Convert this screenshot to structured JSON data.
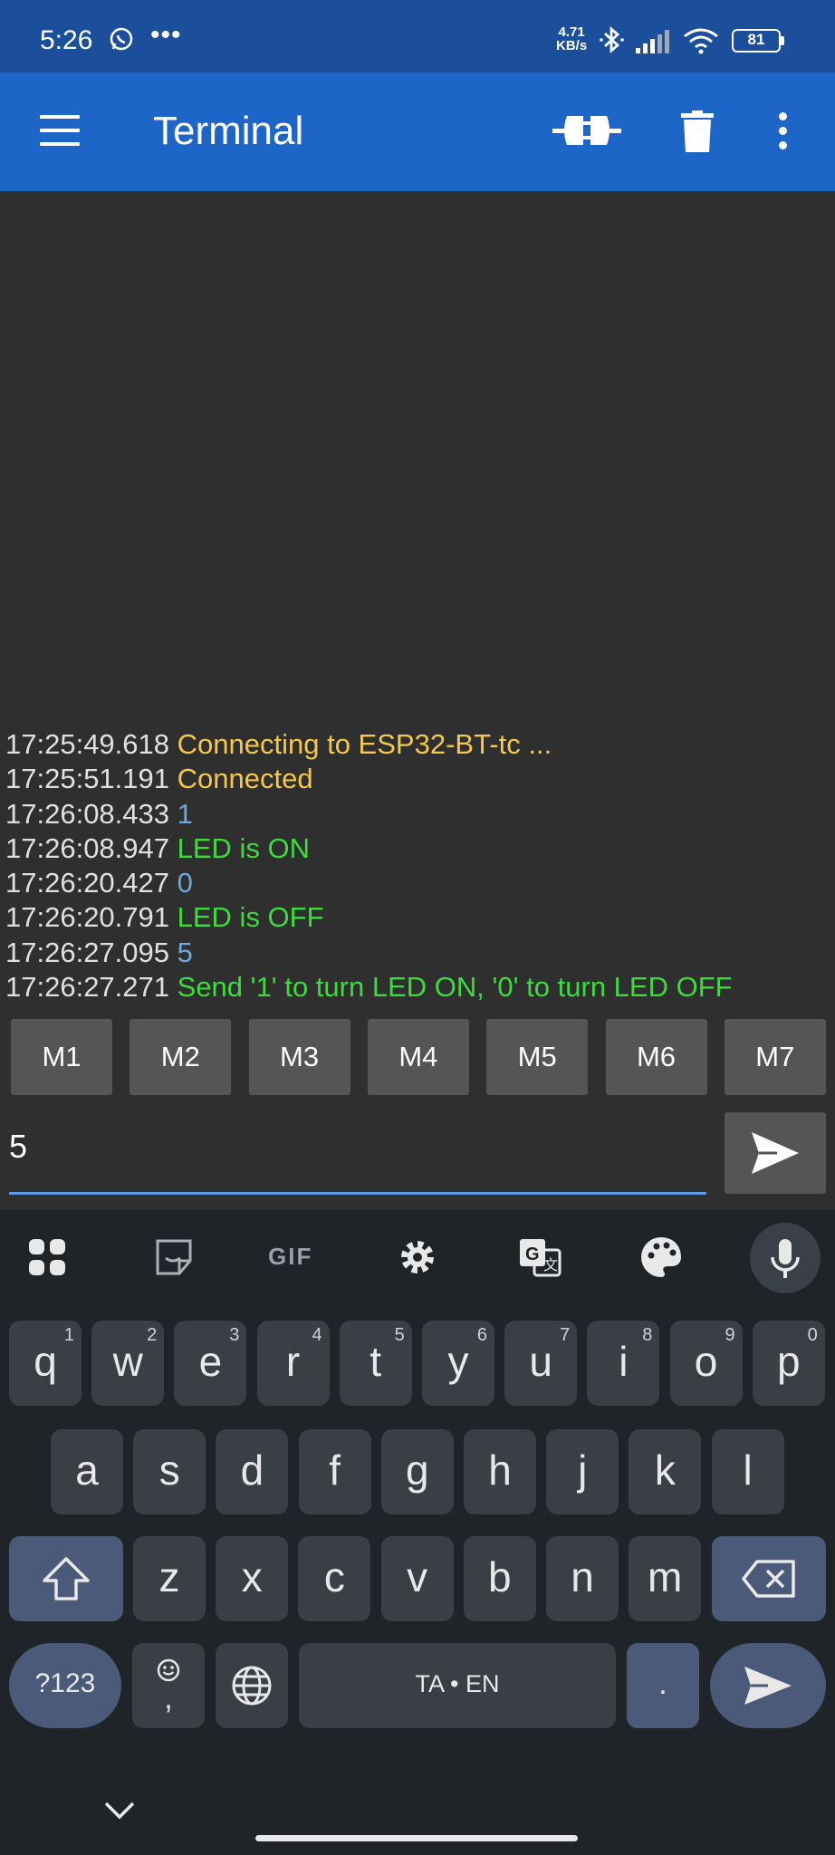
{
  "status_bar": {
    "time": "5:26",
    "dots": "•••",
    "net_speed_value": "4.71",
    "net_speed_unit": "KB/s",
    "battery": "81"
  },
  "app_bar": {
    "title": "Terminal"
  },
  "terminal": {
    "lines": [
      {
        "ts": "17:25:49.618",
        "text": "Connecting to ESP32-BT-tc ...",
        "kind": "status"
      },
      {
        "ts": "17:25:51.191",
        "text": "Connected",
        "kind": "status"
      },
      {
        "ts": "17:26:08.433",
        "text": "1",
        "kind": "sent"
      },
      {
        "ts": "17:26:08.947",
        "text": "LED is ON",
        "kind": "recv"
      },
      {
        "ts": "17:26:20.427",
        "text": "0",
        "kind": "sent"
      },
      {
        "ts": "17:26:20.791",
        "text": "LED is OFF",
        "kind": "recv"
      },
      {
        "ts": "17:26:27.095",
        "text": "5",
        "kind": "sent"
      },
      {
        "ts": "17:26:27.271",
        "text": "Send '1' to turn LED ON, '0' to turn LED OFF",
        "kind": "recv"
      }
    ],
    "colors": {
      "status": "#f4c84b",
      "sent": "#6fa8dc",
      "recv": "#3ddc3d"
    }
  },
  "macros": [
    "M1",
    "M2",
    "M3",
    "M4",
    "M5",
    "M6",
    "M7"
  ],
  "input": {
    "value": "5"
  },
  "keyboard": {
    "toolbar": {
      "gif_label": "GIF"
    },
    "row1": [
      {
        "k": "q",
        "n": "1"
      },
      {
        "k": "w",
        "n": "2"
      },
      {
        "k": "e",
        "n": "3"
      },
      {
        "k": "r",
        "n": "4"
      },
      {
        "k": "t",
        "n": "5"
      },
      {
        "k": "y",
        "n": "6"
      },
      {
        "k": "u",
        "n": "7"
      },
      {
        "k": "i",
        "n": "8"
      },
      {
        "k": "o",
        "n": "9"
      },
      {
        "k": "p",
        "n": "0"
      }
    ],
    "row2": [
      "a",
      "s",
      "d",
      "f",
      "g",
      "h",
      "j",
      "k",
      "l"
    ],
    "row3": [
      "z",
      "x",
      "c",
      "v",
      "b",
      "n",
      "m"
    ],
    "symbols_label": "?123",
    "comma_label": ",",
    "space_label": "TA • EN",
    "period_label": "."
  }
}
